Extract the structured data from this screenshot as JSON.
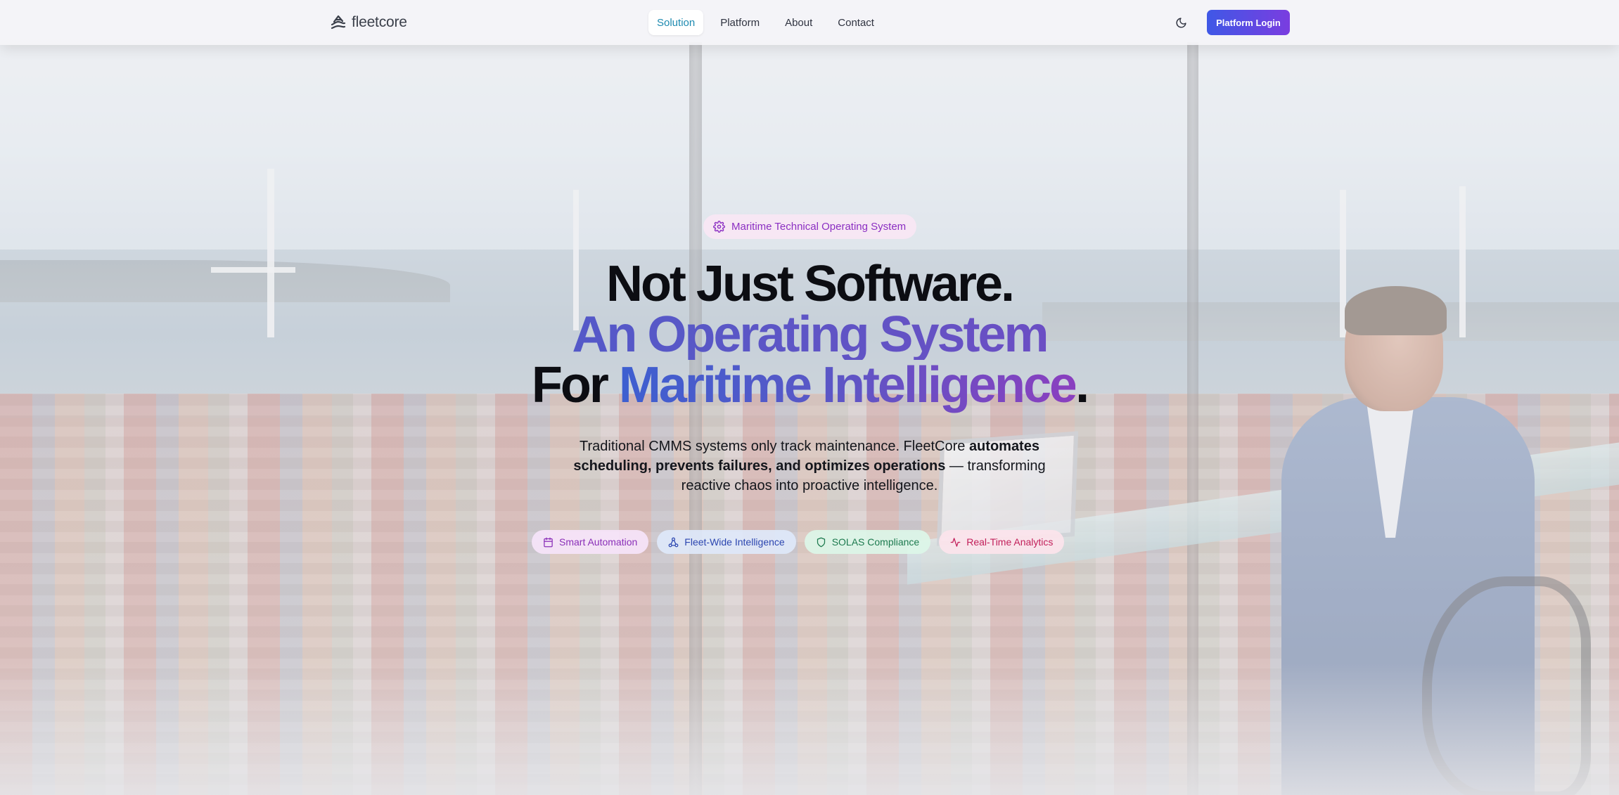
{
  "brand": {
    "name": "fleetcore",
    "logo_icon": "fleet-logo-icon"
  },
  "nav": {
    "items": [
      {
        "label": "Solution",
        "active": true
      },
      {
        "label": "Platform",
        "active": false
      },
      {
        "label": "About",
        "active": false
      },
      {
        "label": "Contact",
        "active": false
      }
    ],
    "theme_icon": "moon-icon",
    "login_label": "Platform Login"
  },
  "hero": {
    "badge": {
      "icon": "gear-icon",
      "label": "Maritime Technical Operating System"
    },
    "headline": {
      "line1": "Not Just Software.",
      "line2": "An Operating System",
      "line3_plain": "For ",
      "line3_gradient": "Maritime Intelligence",
      "line3_period": "."
    },
    "lead": {
      "part1": "Traditional CMMS systems only track maintenance. FleetCore ",
      "bold": "automates scheduling, prevents failures, and optimizes operations",
      "part2": " — transforming reactive chaos into proactive intelligence."
    },
    "pills": [
      {
        "icon": "calendar-icon",
        "label": "Smart Automation"
      },
      {
        "icon": "network-icon",
        "label": "Fleet-Wide Intelligence"
      },
      {
        "icon": "shield-icon",
        "label": "SOLAS Compliance"
      },
      {
        "icon": "activity-icon",
        "label": "Real-Time Analytics"
      }
    ]
  },
  "colors": {
    "accent_start": "#3f58e6",
    "accent_end": "#7a3de0",
    "active_nav": "#1d8ab0"
  }
}
